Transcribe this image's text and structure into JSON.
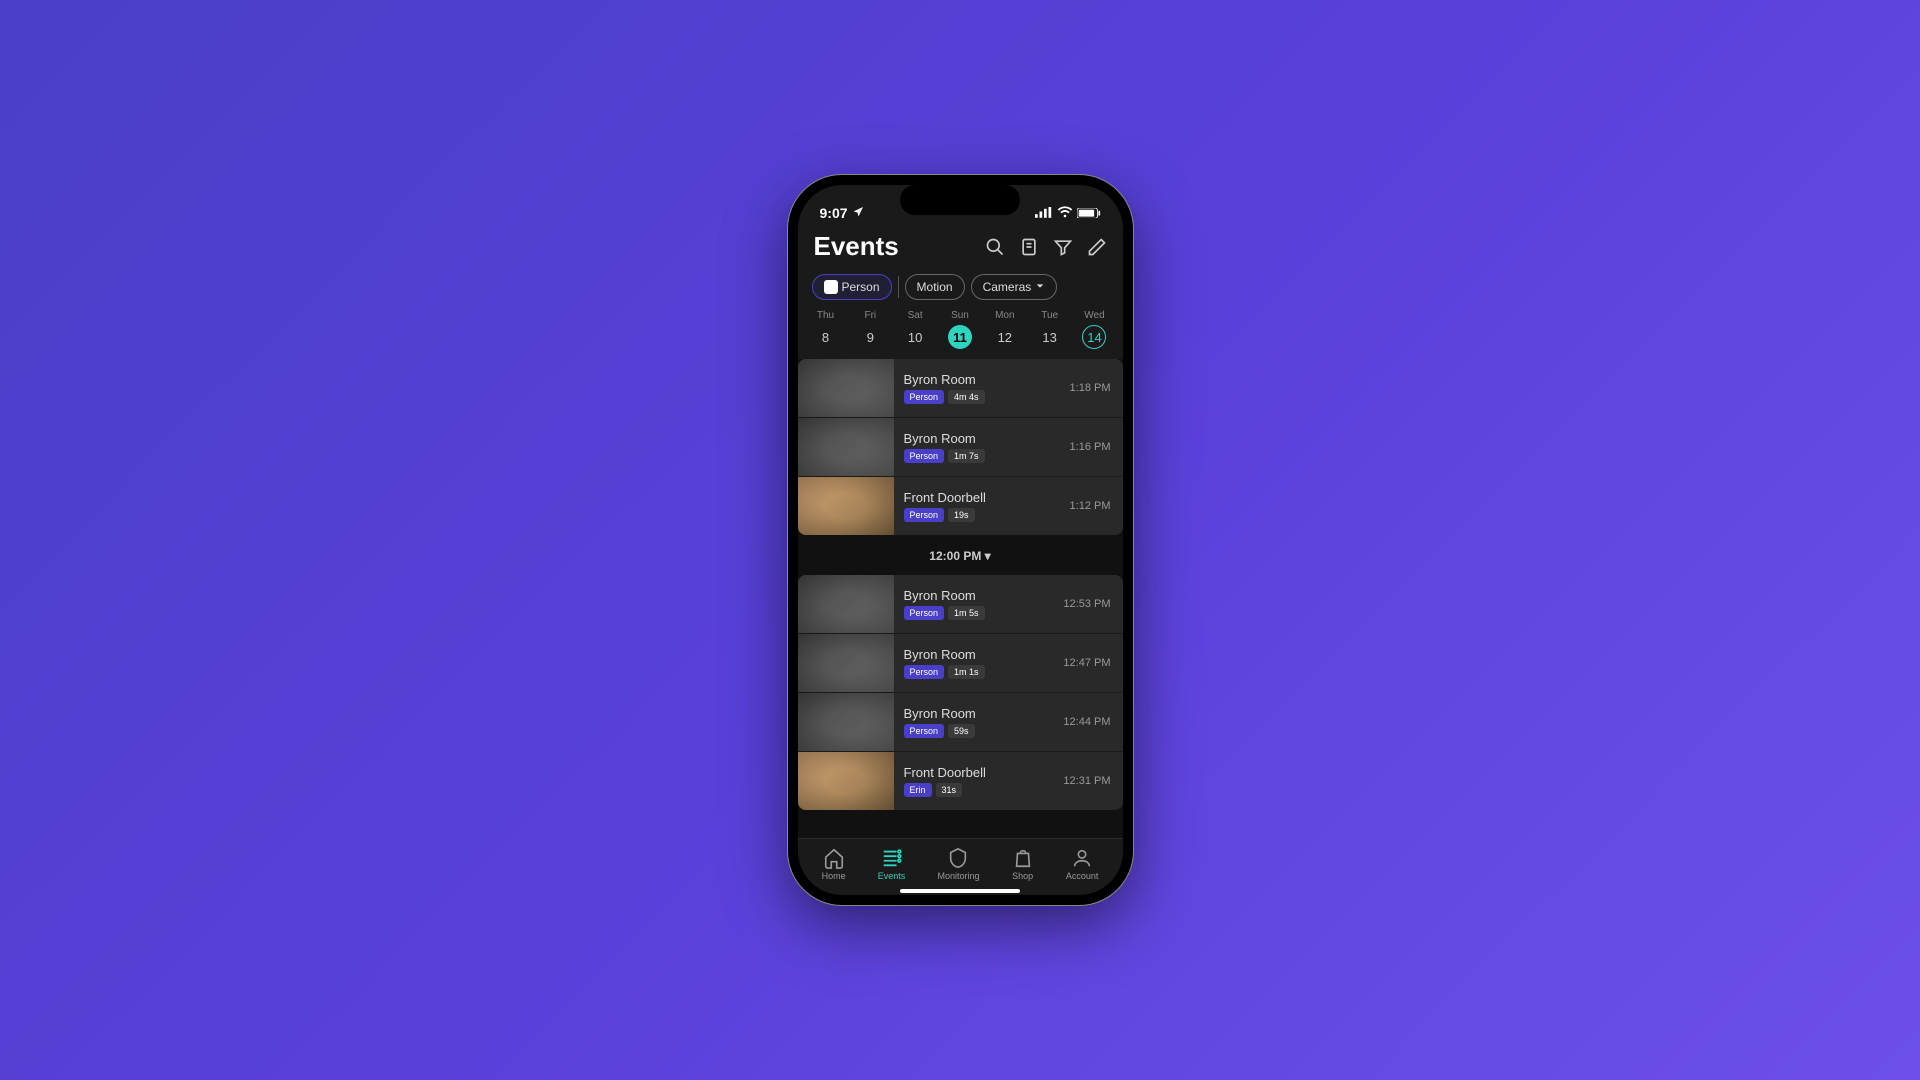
{
  "status": {
    "time": "9:07",
    "location_icon": true
  },
  "header": {
    "title": "Events"
  },
  "filters": [
    {
      "label": "Person",
      "active": true,
      "icon": "shield"
    },
    {
      "label": "Motion",
      "active": false
    },
    {
      "label": "Cameras",
      "active": false,
      "dropdown": true
    }
  ],
  "calendar": {
    "days": [
      {
        "name": "Thu",
        "num": "8"
      },
      {
        "name": "Fri",
        "num": "9"
      },
      {
        "name": "Sat",
        "num": "10"
      },
      {
        "name": "Sun",
        "num": "11",
        "selected": true
      },
      {
        "name": "Mon",
        "num": "12"
      },
      {
        "name": "Tue",
        "num": "13"
      },
      {
        "name": "Wed",
        "num": "14",
        "today": true
      }
    ]
  },
  "groups": [
    {
      "events": [
        {
          "camera": "Byron Room",
          "tag": "Person",
          "duration": "4m 4s",
          "time": "1:18 PM",
          "thumb": "room"
        },
        {
          "camera": "Byron Room",
          "tag": "Person",
          "duration": "1m 7s",
          "time": "1:16 PM",
          "thumb": "room"
        },
        {
          "camera": "Front Doorbell",
          "tag": "Person",
          "duration": "19s",
          "time": "1:12 PM",
          "thumb": "doorbell"
        }
      ]
    },
    {
      "header": "12:00 PM",
      "events": [
        {
          "camera": "Byron Room",
          "tag": "Person",
          "duration": "1m 5s",
          "time": "12:53 PM",
          "thumb": "room"
        },
        {
          "camera": "Byron Room",
          "tag": "Person",
          "duration": "1m 1s",
          "time": "12:47 PM",
          "thumb": "room"
        },
        {
          "camera": "Byron Room",
          "tag": "Person",
          "duration": "59s",
          "time": "12:44 PM",
          "thumb": "room"
        },
        {
          "camera": "Front Doorbell",
          "tag": "Erin",
          "duration": "31s",
          "time": "12:31 PM",
          "thumb": "doorbell"
        }
      ]
    }
  ],
  "nav": [
    {
      "label": "Home",
      "icon": "home"
    },
    {
      "label": "Events",
      "icon": "events",
      "active": true
    },
    {
      "label": "Monitoring",
      "icon": "shield"
    },
    {
      "label": "Shop",
      "icon": "bag"
    },
    {
      "label": "Account",
      "icon": "account"
    }
  ]
}
